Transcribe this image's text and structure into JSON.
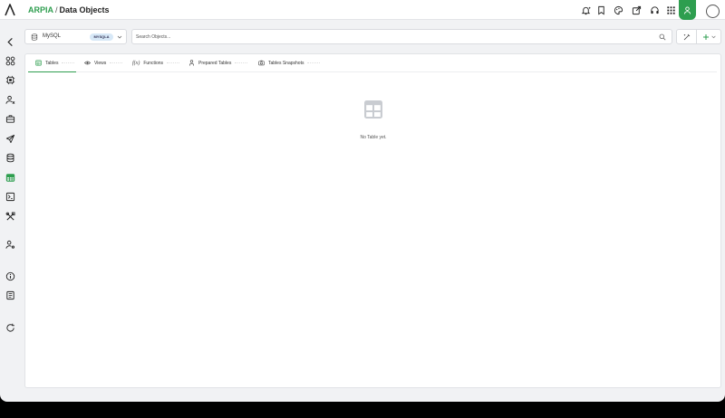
{
  "header": {
    "brand": "ARPIA",
    "separator": "/",
    "title": "Data Objects"
  },
  "topbar_icons": [
    "bell-icon",
    "bookmark-icon",
    "palette-icon",
    "share-icon",
    "headset-icon",
    "apps-grid-icon",
    "user-icon"
  ],
  "sidebar": {
    "items": [
      "back-arrow-icon",
      "apps-icon",
      "chip-icon",
      "user-settings-icon",
      "toolbox-icon",
      "send-icon",
      "database-icon",
      "table-icon",
      "terminal-icon",
      "tools-icon",
      "user-gear-icon",
      "info-icon",
      "book-icon",
      "refresh-icon"
    ],
    "active_index": 7
  },
  "database": {
    "name": "MySQL",
    "badge": "MYSQLA"
  },
  "search": {
    "placeholder": "Search Objects..."
  },
  "tabs": [
    {
      "label": "Tables",
      "icon": "table-icon",
      "active": true
    },
    {
      "label": "Views",
      "icon": "eye-icon",
      "active": false
    },
    {
      "label": "Functions",
      "icon": "function-icon",
      "active": false
    },
    {
      "label": "Prepared Tables",
      "icon": "person-icon",
      "active": false
    },
    {
      "label": "Tables Snapshots",
      "icon": "camera-icon",
      "active": false
    }
  ],
  "empty_state": {
    "message": "No Table yet."
  },
  "colors": {
    "accent": "#2e9e4f",
    "badge_bg": "#d7e8f7",
    "background": "#f1f2f4"
  }
}
